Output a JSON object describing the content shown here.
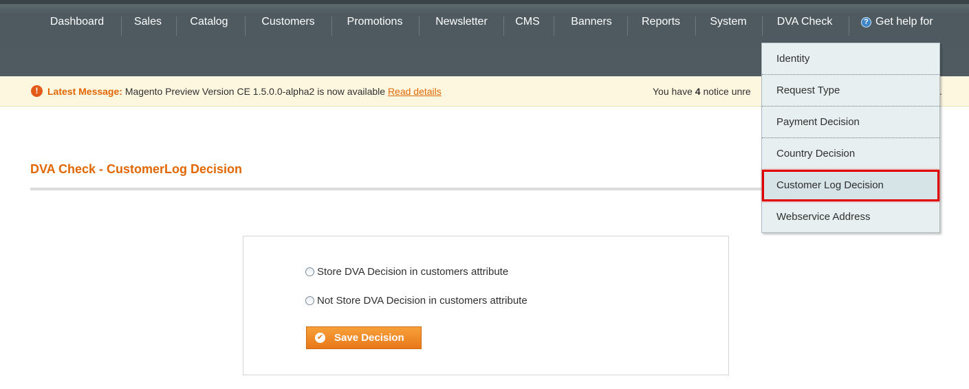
{
  "nav": {
    "items": [
      "Dashboard",
      "Sales",
      "Catalog",
      "Customers",
      "Promotions",
      "Newsletter",
      "CMS",
      "Banners",
      "Reports",
      "System",
      "DVA Check"
    ],
    "help_label": "Get help for"
  },
  "message": {
    "label": "Latest Message:",
    "text": "Magento Preview Version CE 1.5.0.0-alpha2 is now available",
    "link": "Read details",
    "notice_prefix": "You have",
    "notice_count": "4",
    "notice_suffix": "notice unre",
    "end_char": "."
  },
  "page": {
    "title": "DVA Check - CustomerLog Decision"
  },
  "form": {
    "option_store": "Store DVA Decision in customers attribute",
    "option_not_store": "Not Store DVA Decision in customers attribute",
    "save_label": "Save Decision"
  },
  "dropdown": {
    "items": [
      "Identity",
      "Request Type",
      "Payment Decision",
      "Country Decision",
      "Customer Log Decision",
      "Webservice Address"
    ],
    "selected": "Customer Log Decision"
  },
  "colors": {
    "accent": "#e26703",
    "nav_bg": "#4f5b60",
    "highlight": "#e00000"
  }
}
